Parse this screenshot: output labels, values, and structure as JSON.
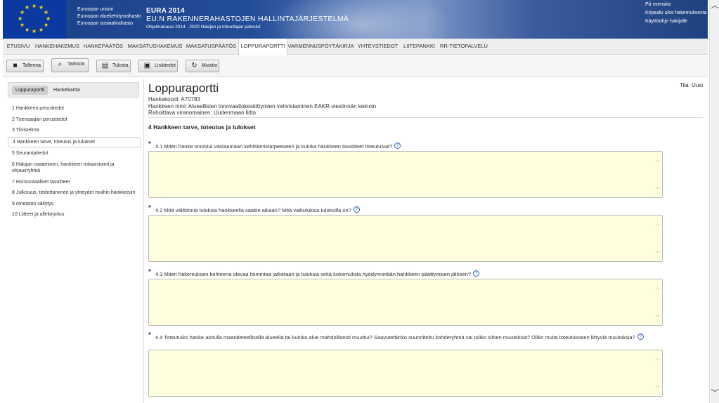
{
  "banner": {
    "fund_lines": [
      "Euroopan unioni",
      "Euroopan aluekehitysrahasto",
      "Euroopan sosiaalirahasto"
    ],
    "title1": "EURA 2014",
    "title2": "EU:N RAKENNERAHASTOJEN HALLINTAJÄRJESTELMÄ",
    "title3": "Ohjelmakausi 2014 - 2020 Hakijan ja toteuttajan palvelut",
    "links": [
      "På svenska",
      "Kirjaudu ulos hakemuksesta",
      "Käyttöohje hakijalle"
    ]
  },
  "nav": {
    "items": [
      "ETUSIVU",
      "HANKEHAKEMUS",
      "HANKEPÄÄTÖS",
      "MAKSATUSHAKEMUS",
      "MAKSATUSPÄÄTÖS",
      "LOPPURAPORTTI",
      "VARMENNUSPÖYTÄKIRJA",
      "YHTEYSTIEDOT",
      "LIITEPANKKI",
      "RR-TIETOPALVELU"
    ],
    "active": "LOPPURAPORTTI"
  },
  "toolbar": {
    "save": "Tallenna",
    "check": "Tarkista",
    "print": "Tulosta",
    "info": "Lisätiedot",
    "memo": "Muistio"
  },
  "sidebar": {
    "tabs": [
      "Loppuraportti",
      "Hankekartta"
    ],
    "items": [
      "1 Hankkeen perustiedot",
      "2 Tuensaajan perustiedot",
      "3 Tiivistelmä",
      "4 Hankkeen tarve, toteutus ja tulokset",
      "5 Seurantatiedot",
      "6 Hakijan osaaminen, hankkeen riskiarviointi ja ohjausryhmä",
      "7 Horisontaaliset tavoitteet",
      "8 Julkisuus, tiedottaminen ja yhteydet muihin hankkeisiin",
      "9 Aineiston säilytys",
      "10 Liitteet ja allekirjoitus"
    ],
    "active_index": 3
  },
  "main": {
    "title": "Loppuraportti",
    "status": "Tila: Uusi",
    "code": "Hankekoodi: A70783",
    "name": "Hankkeen nimi: Alueellisten innovaatiokeskittymien vahvistaminen EAKR-viestinnän keinoin",
    "funder": "Rahoittava viranomainen: Uudenmaan liitto",
    "section": "4 Hankkeen tarve, toteutus ja tulokset",
    "questions": [
      "4.1 Miten hanke onnistui vastaamaan kehittämistarpeeseen ja kuinka hankkeen tavoitteet toteutuivat?",
      "4.2 Mitä välittömiä tuloksia hankkeella saatiin aikaan? Mitä vaikutuksia tuloksilla on?",
      "4.3 Miten hakemuksen kohteena olevaa toimintaa jatketaan ja tuloksia sekä kokemuksia hyödynnetään hankkeen päättymisen jälkeen?",
      "4.4 Toteutuiko hanke aiotulla maantieteellisellä alueella tai kuinka alue mahdollisesti muuttui? Saavutettiinko suunniteltu kohderyhmä vai tuliko siihen muutoksia? Oliko muita toteutukseen liittyviä muutoksia?"
    ],
    "answers": [
      "",
      "",
      "",
      ""
    ]
  }
}
